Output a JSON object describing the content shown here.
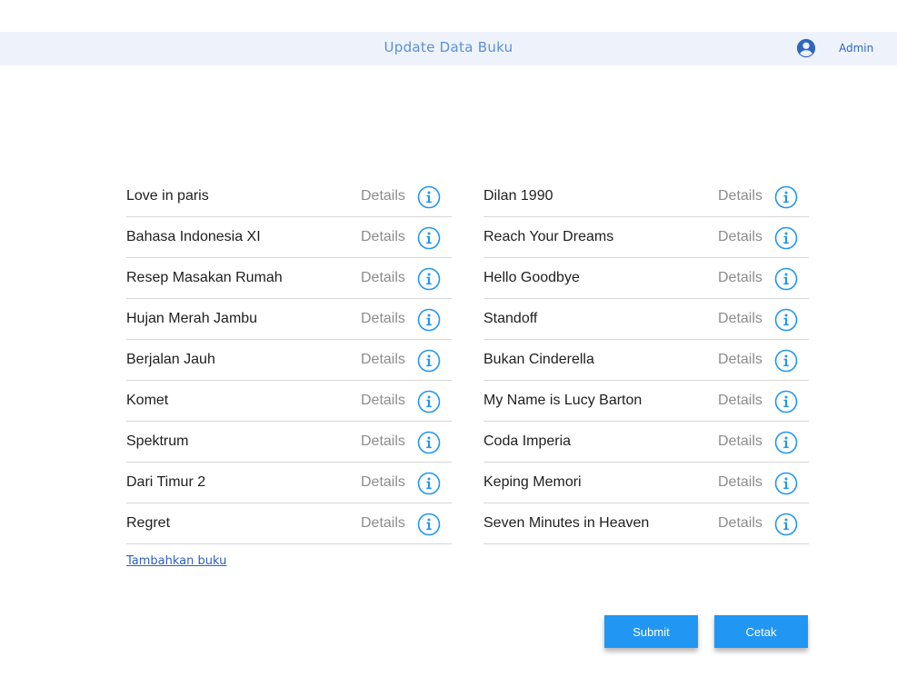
{
  "header": {
    "title": "Update Data Buku",
    "user_label": "Admin"
  },
  "books_left": [
    {
      "title": "Love in paris",
      "details": "Details"
    },
    {
      "title": "Bahasa Indonesia XI",
      "details": "Details"
    },
    {
      "title": "Resep Masakan Rumah",
      "details": "Details"
    },
    {
      "title": "Hujan Merah Jambu",
      "details": "Details"
    },
    {
      "title": "Berjalan Jauh",
      "details": "Details"
    },
    {
      "title": "Komet",
      "details": "Details"
    },
    {
      "title": "Spektrum",
      "details": "Details"
    },
    {
      "title": "Dari Timur 2",
      "details": "Details"
    },
    {
      "title": "Regret",
      "details": "Details"
    }
  ],
  "books_right": [
    {
      "title": "Dilan 1990",
      "details": "Details"
    },
    {
      "title": "Reach Your Dreams",
      "details": "Details"
    },
    {
      "title": "Hello Goodbye",
      "details": "Details"
    },
    {
      "title": "Standoff",
      "details": "Details"
    },
    {
      "title": "Bukan Cinderella",
      "details": "Details"
    },
    {
      "title": "My Name is Lucy Barton",
      "details": "Details"
    },
    {
      "title": "Coda Imperia",
      "details": "Details"
    },
    {
      "title": "Keping Memori",
      "details": "Details"
    },
    {
      "title": "Seven Minutes in Heaven",
      "details": "Details"
    }
  ],
  "add_book_label": "Tambahkan buku",
  "buttons": {
    "submit_label": "Submit",
    "print_label": "Cetak"
  },
  "icons": {
    "user": "account-circle-icon",
    "info": "info-circle-icon"
  },
  "colors": {
    "header_bg": "#eef3fb",
    "title": "#5d8fd6",
    "accent": "#2196f3",
    "link": "#2a5fc7"
  }
}
